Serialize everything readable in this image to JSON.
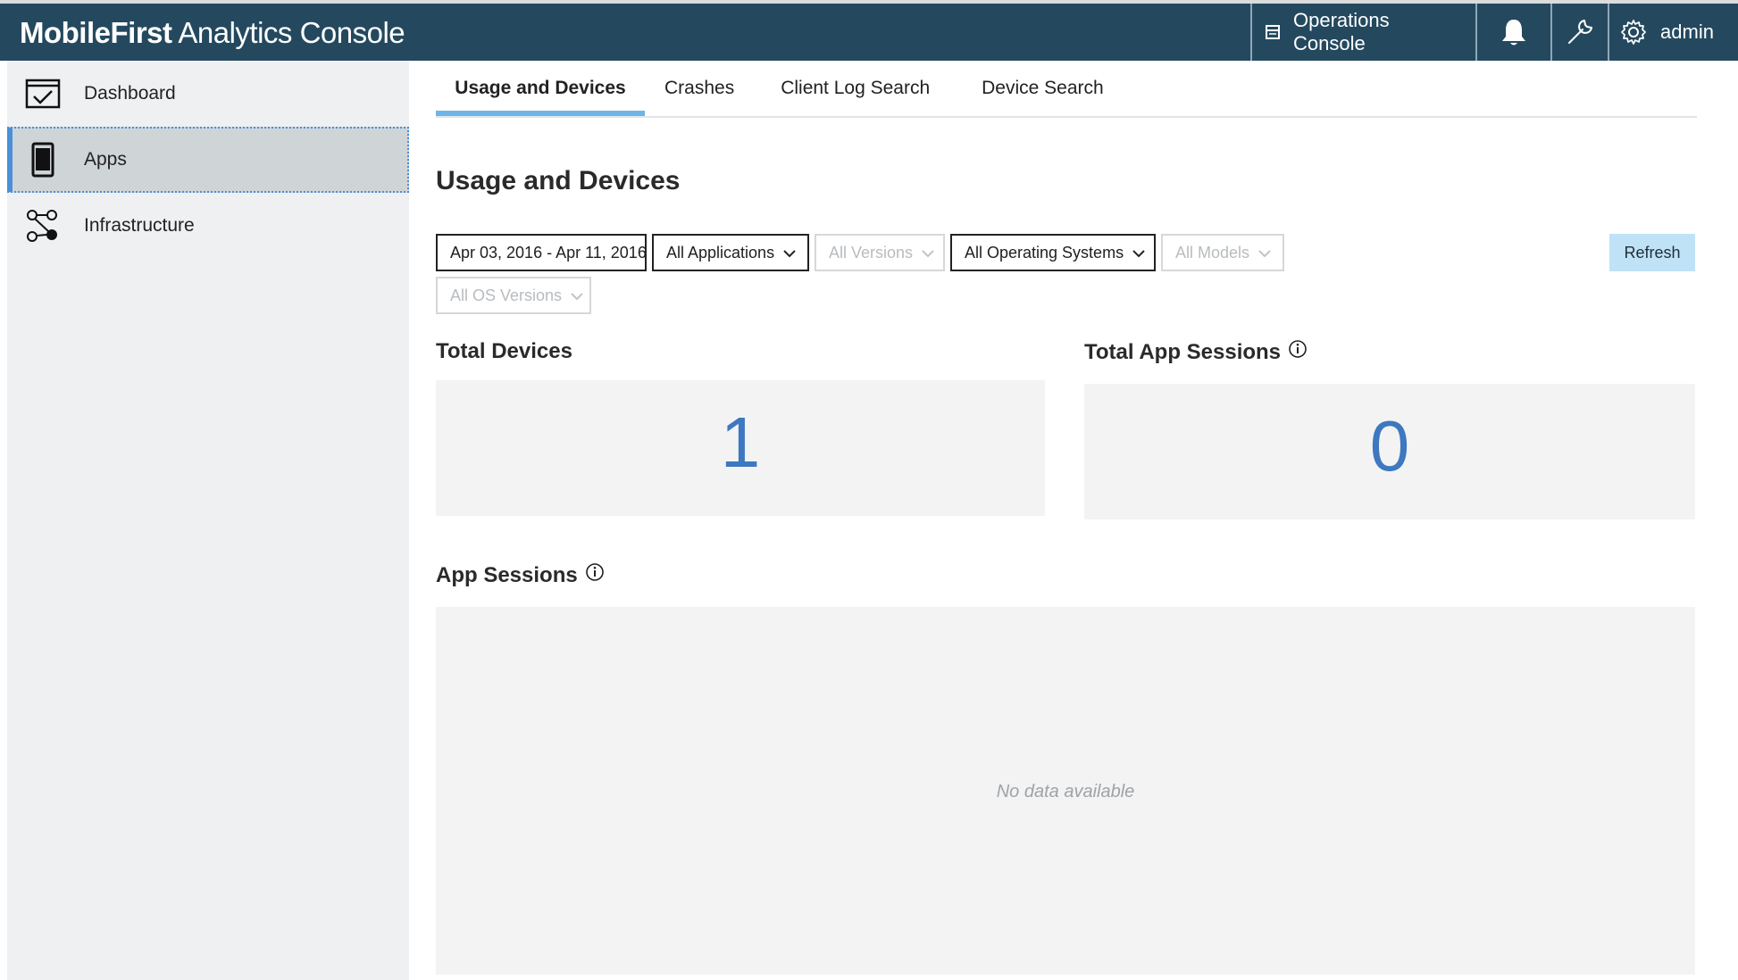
{
  "header": {
    "brand_bold": "MobileFirst",
    "brand_rest": " Analytics Console",
    "operations_console": "Operations Console",
    "user": "admin"
  },
  "sidebar": {
    "items": [
      {
        "label": "Dashboard",
        "icon": "dashboard-icon"
      },
      {
        "label": "Apps",
        "icon": "mobile-device-icon",
        "active": true
      },
      {
        "label": "Infrastructure",
        "icon": "network-nodes-icon"
      }
    ]
  },
  "tabs": [
    {
      "label": "Usage and Devices",
      "active": true
    },
    {
      "label": "Crashes"
    },
    {
      "label": "Client Log Search"
    },
    {
      "label": "Device Search"
    }
  ],
  "page": {
    "title": "Usage and Devices"
  },
  "filters": {
    "date_range": "Apr 03, 2016 - Apr 11, 2016",
    "applications": "All Applications",
    "versions": "All Versions",
    "operating_systems": "All Operating Systems",
    "models": "All Models",
    "os_versions": "All OS Versions",
    "refresh_label": "Refresh"
  },
  "stats": {
    "total_devices_label": "Total Devices",
    "total_devices_value": "1",
    "total_sessions_label": "Total App Sessions",
    "total_sessions_value": "0"
  },
  "app_sessions": {
    "title": "App Sessions",
    "empty_text": "No data available"
  },
  "colors": {
    "header_bg": "#24495f",
    "accent": "#6fb4e8",
    "number": "#3d78c0",
    "refresh_bg": "#bfe2f7"
  }
}
